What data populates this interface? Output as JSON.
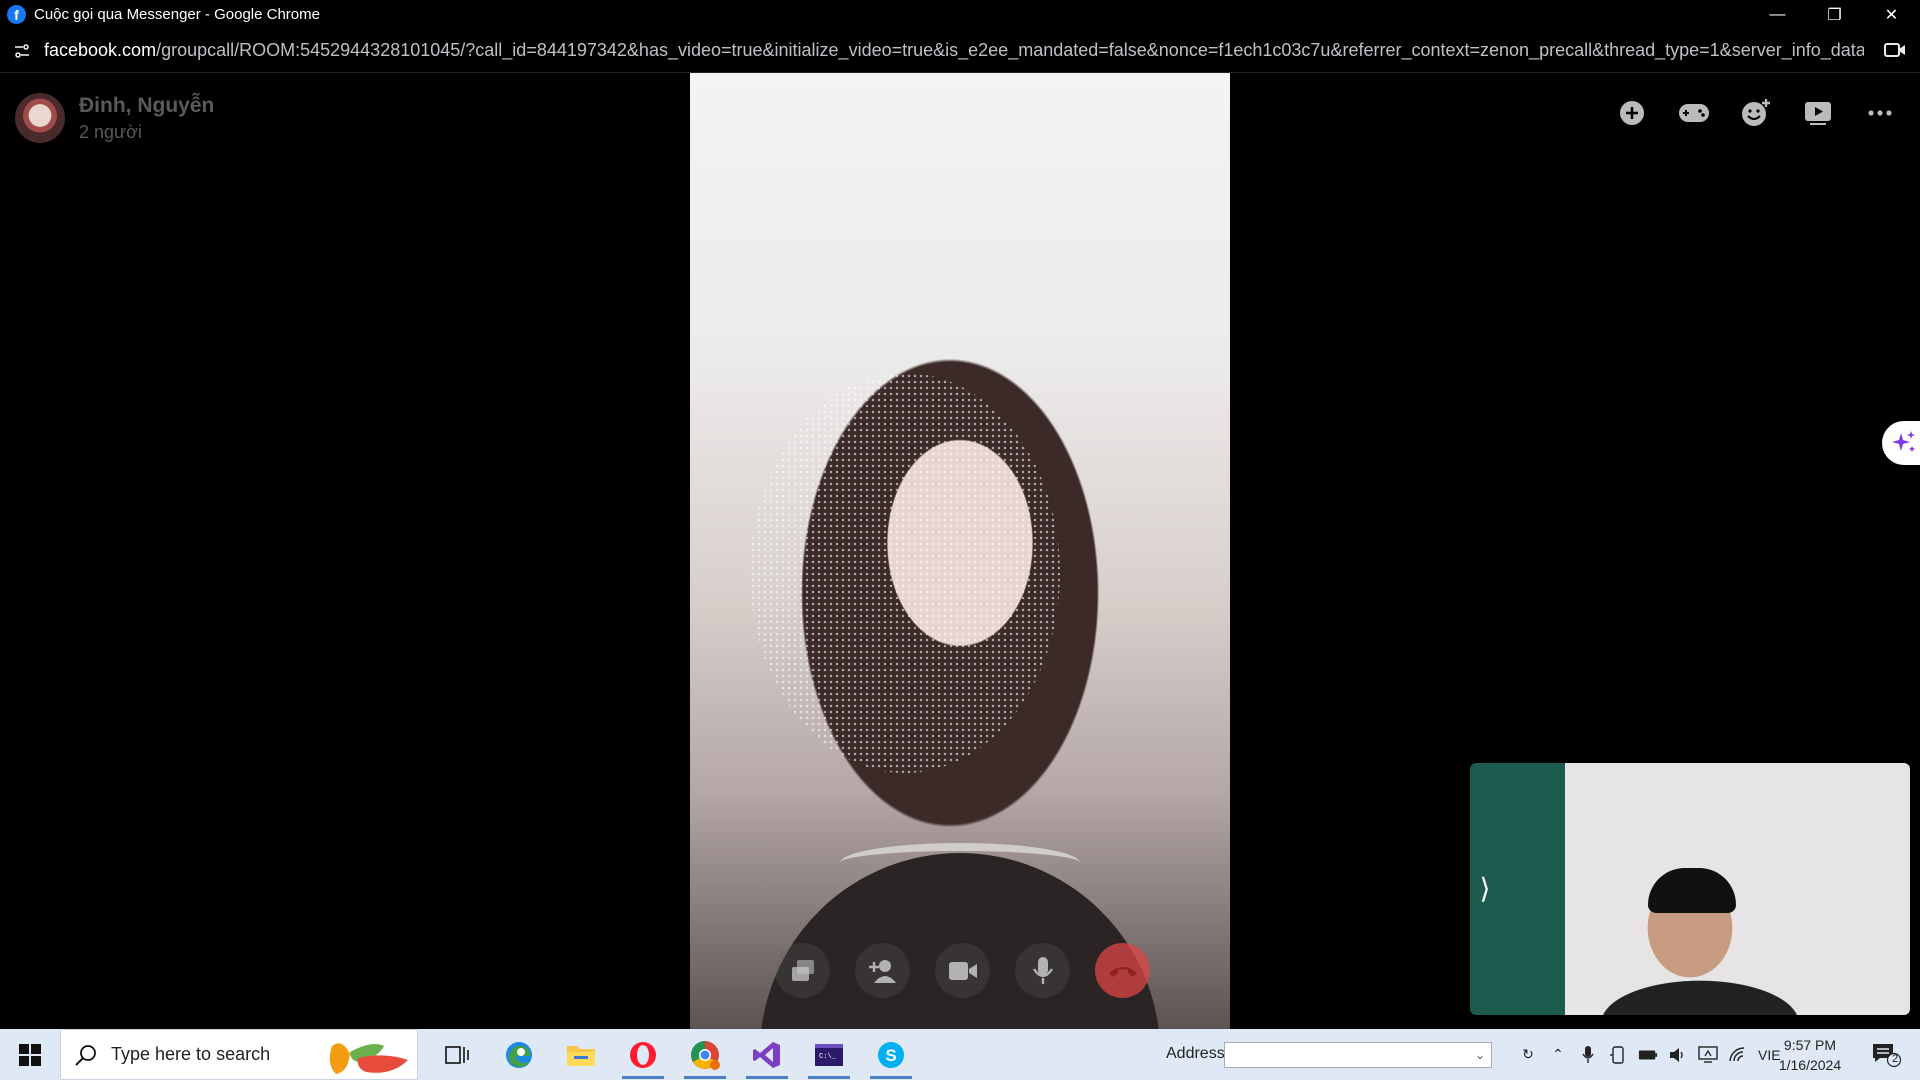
{
  "window": {
    "title": "Cuộc gọi qua Messenger - Google Chrome",
    "minimize_glyph": "—",
    "restore_glyph": "❐",
    "close_glyph": "✕"
  },
  "addressbar": {
    "url_domain": "facebook.com",
    "url_path": "/groupcall/ROOM:5452944328101045/?call_id=844197342&has_video=true&initialize_video=true&is_e2ee_mandated=false&nonce=f1ech1c03c7u&referrer_context=zenon_precall&thread_type=1&server_info_data=GA..."
  },
  "call": {
    "caller_name": "Đinh, Nguyễn",
    "participants": "2 người",
    "top_actions": [
      "add-icon",
      "game-icon",
      "emoji-add-icon",
      "play-icon",
      "more-icon"
    ],
    "controls": [
      "share-screen-icon",
      "add-person-icon",
      "video-camera-icon",
      "microphone-icon",
      "end-call-icon"
    ],
    "end_call_color": "#dc4646",
    "self_view_toggle": "⟩"
  },
  "taskbar": {
    "search_placeholder": "Type here to search",
    "pinned_apps": [
      "task-view-icon",
      "edge-icon",
      "file-explorer-icon",
      "opera-icon",
      "chrome-icon",
      "visual-studio-icon",
      "terminal-icon",
      "skype-icon"
    ],
    "address_label": "Address",
    "language": "VIE",
    "time": "9:57 PM",
    "date": "1/16/2024",
    "notification_count": "2"
  }
}
